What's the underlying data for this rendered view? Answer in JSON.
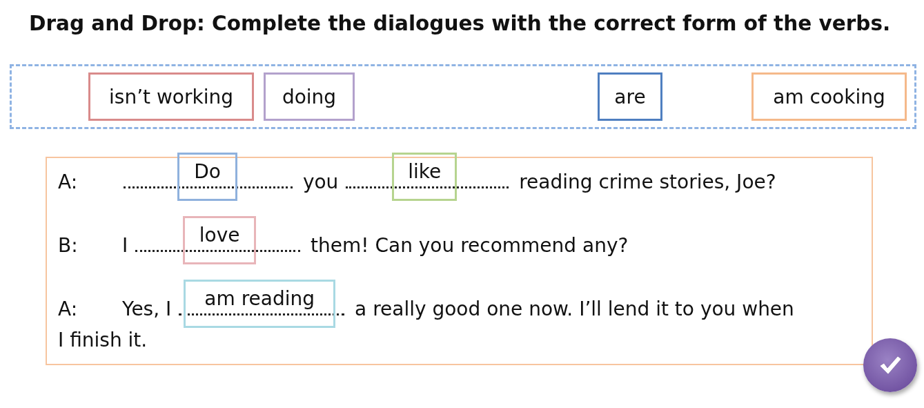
{
  "instruction": "Drag and Drop: Complete the dialogues with the correct form of the verbs.",
  "word_bank": [
    {
      "text": "isn’t working",
      "color": "#d98b8b"
    },
    {
      "text": "doing",
      "color": "#b3a1cc"
    },
    {
      "text": "are",
      "color": "#4f7fc0"
    },
    {
      "text": "am cooking",
      "color": "#f5b98a"
    }
  ],
  "dialogue": [
    {
      "speaker": "A:",
      "parts": [
        {
          "kind": "blank",
          "answer": "Do",
          "color": "#8fb1dd"
        },
        {
          "kind": "text",
          "text": "you"
        },
        {
          "kind": "blank",
          "answer": "like",
          "color": "#b6d48f"
        },
        {
          "kind": "text",
          "text": "reading crime stories, Joe?"
        }
      ]
    },
    {
      "speaker": "B:",
      "parts": [
        {
          "kind": "text",
          "text": "I"
        },
        {
          "kind": "blank",
          "answer": "love",
          "color": "#e8b5b9"
        },
        {
          "kind": "text",
          "text": "them! Can you recommend any?"
        }
      ]
    },
    {
      "speaker": "A:",
      "parts": [
        {
          "kind": "text",
          "text": "Yes, I"
        },
        {
          "kind": "blank",
          "answer": "am reading",
          "color": "#a9d9e3"
        },
        {
          "kind": "text",
          "text": "a really good one now. I’ll lend it to you when"
        },
        {
          "kind": "text",
          "text": "I finish it."
        }
      ]
    }
  ]
}
